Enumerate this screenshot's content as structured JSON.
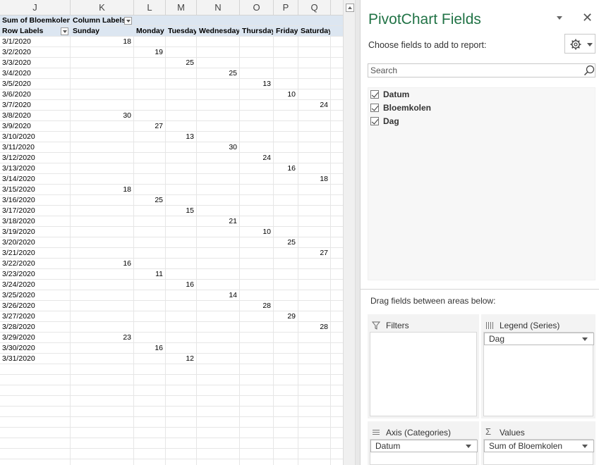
{
  "sheet": {
    "columns": [
      "J",
      "K",
      "L",
      "M",
      "N",
      "O",
      "P",
      "Q"
    ],
    "pivot_header": {
      "values_label": "Sum of Bloemkolen",
      "column_labels": "Column Labels",
      "row_labels": "Row Labels"
    },
    "days": [
      "Sunday",
      "Monday",
      "Tuesday",
      "Wednesday",
      "Thursday",
      "Friday",
      "Saturday"
    ],
    "rows": [
      {
        "date": "3/1/2020",
        "day_index": 0,
        "value": "18"
      },
      {
        "date": "3/2/2020",
        "day_index": 1,
        "value": "19"
      },
      {
        "date": "3/3/2020",
        "day_index": 2,
        "value": "25"
      },
      {
        "date": "3/4/2020",
        "day_index": 3,
        "value": "25"
      },
      {
        "date": "3/5/2020",
        "day_index": 4,
        "value": "13"
      },
      {
        "date": "3/6/2020",
        "day_index": 5,
        "value": "10"
      },
      {
        "date": "3/7/2020",
        "day_index": 6,
        "value": "24"
      },
      {
        "date": "3/8/2020",
        "day_index": 0,
        "value": "30"
      },
      {
        "date": "3/9/2020",
        "day_index": 1,
        "value": "27"
      },
      {
        "date": "3/10/2020",
        "day_index": 2,
        "value": "13"
      },
      {
        "date": "3/11/2020",
        "day_index": 3,
        "value": "30"
      },
      {
        "date": "3/12/2020",
        "day_index": 4,
        "value": "24"
      },
      {
        "date": "3/13/2020",
        "day_index": 5,
        "value": "16"
      },
      {
        "date": "3/14/2020",
        "day_index": 6,
        "value": "18"
      },
      {
        "date": "3/15/2020",
        "day_index": 0,
        "value": "18"
      },
      {
        "date": "3/16/2020",
        "day_index": 1,
        "value": "25"
      },
      {
        "date": "3/17/2020",
        "day_index": 2,
        "value": "15"
      },
      {
        "date": "3/18/2020",
        "day_index": 3,
        "value": "21"
      },
      {
        "date": "3/19/2020",
        "day_index": 4,
        "value": "10"
      },
      {
        "date": "3/20/2020",
        "day_index": 5,
        "value": "25"
      },
      {
        "date": "3/21/2020",
        "day_index": 6,
        "value": "27"
      },
      {
        "date": "3/22/2020",
        "day_index": 0,
        "value": "16"
      },
      {
        "date": "3/23/2020",
        "day_index": 1,
        "value": "11"
      },
      {
        "date": "3/24/2020",
        "day_index": 2,
        "value": "16"
      },
      {
        "date": "3/25/2020",
        "day_index": 3,
        "value": "14"
      },
      {
        "date": "3/26/2020",
        "day_index": 4,
        "value": "28"
      },
      {
        "date": "3/27/2020",
        "day_index": 5,
        "value": "29"
      },
      {
        "date": "3/28/2020",
        "day_index": 6,
        "value": "28"
      },
      {
        "date": "3/29/2020",
        "day_index": 0,
        "value": "23"
      },
      {
        "date": "3/30/2020",
        "day_index": 1,
        "value": "16"
      },
      {
        "date": "3/31/2020",
        "day_index": 2,
        "value": "12"
      }
    ]
  },
  "pane": {
    "title": "PivotChart Fields",
    "choose_label": "Choose fields to add to report:",
    "search_placeholder": "Search",
    "fields": [
      {
        "label": "Datum",
        "checked": true
      },
      {
        "label": "Bloemkolen",
        "checked": true
      },
      {
        "label": "Dag",
        "checked": true
      }
    ],
    "drag_label": "Drag fields between areas below:",
    "areas": {
      "filters": {
        "title": "Filters"
      },
      "legend": {
        "title": "Legend (Series)",
        "field": "Dag"
      },
      "axis": {
        "title": "Axis (Categories)",
        "field": "Datum"
      },
      "values": {
        "title": "Values",
        "field": "Sum of Bloemkolen"
      }
    }
  },
  "colors": {
    "accent": "#217346",
    "pivot_header_bg": "#dce6f1"
  }
}
